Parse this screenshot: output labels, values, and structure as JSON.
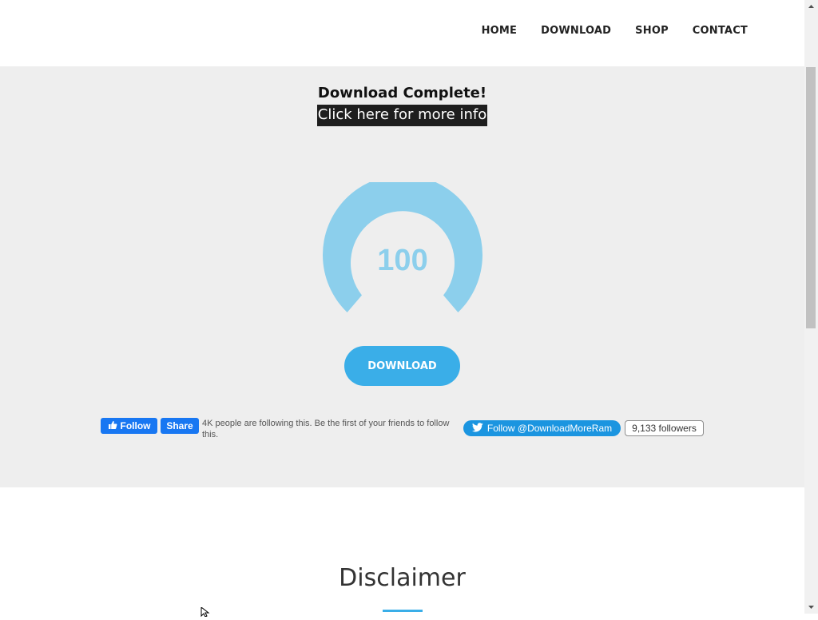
{
  "nav": {
    "items": [
      "HOME",
      "DOWNLOAD",
      "SHOP",
      "CONTACT"
    ]
  },
  "hero": {
    "status_title": "Download Complete!",
    "info_link": "Click here for more info",
    "gauge": {
      "value": "100",
      "color": "#8ccfec"
    },
    "download_button": "DOWNLOAD"
  },
  "facebook": {
    "follow_label": "Follow",
    "share_label": "Share",
    "text": "4K people are following this. Be the first of your friends to follow this.",
    "color": "#1877f2"
  },
  "twitter": {
    "follow_label": "Follow @DownloadMoreRam",
    "followers": "9,133 followers",
    "color": "#1b95e0"
  },
  "disclaimer": {
    "title": "Disclaimer"
  },
  "colors": {
    "accent": "#3aaee8",
    "hero_bg": "#eeeeee"
  }
}
